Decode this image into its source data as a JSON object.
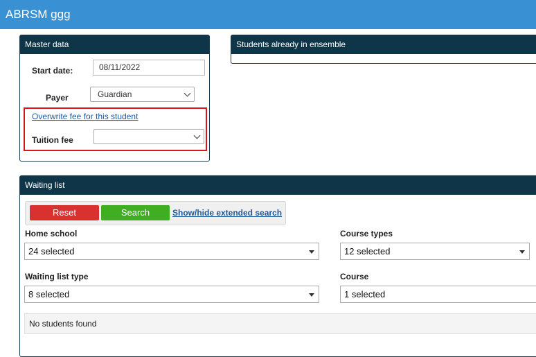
{
  "app": {
    "title": "ABRSM ggg"
  },
  "master": {
    "heading": "Master data",
    "start_date_label": "Start date:",
    "start_date_value": "08/11/2022",
    "payer_label": "Payer",
    "payer_value": "Guardian",
    "overwrite_link": "Overwrite fee for this student",
    "tuition_label": "Tuition fee",
    "tuition_value": "",
    "highlight_color": "#d9141c"
  },
  "ensemble": {
    "heading": "Students already in ensemble"
  },
  "waiting": {
    "heading": "Waiting list",
    "reset_label": "Reset",
    "search_label": "Search",
    "toggle_link": "Show/hide extended search",
    "home_school_label": "Home school",
    "home_school_value": "24 selected",
    "course_types_label": "Course types",
    "course_types_value": "12 selected",
    "waiting_type_label": "Waiting list type",
    "waiting_type_value": "8 selected",
    "course_label": "Course",
    "course_value": "1 selected",
    "empty_message": "No students found"
  },
  "colors": {
    "header_bar": "#3991d4",
    "panel_head": "#0f3648",
    "reset": "#d93030",
    "search": "#3fae20",
    "link": "#1b5b9e"
  }
}
